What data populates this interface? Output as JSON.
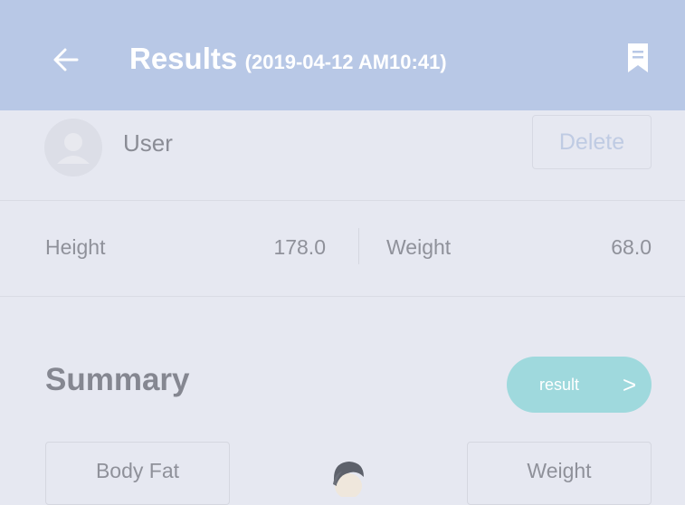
{
  "header": {
    "back_icon": "arrow-left-icon",
    "title": "Results",
    "timestamp": "(2019-04-12 AM10:41)",
    "bookmark_icon": "bookmark-icon",
    "background": "#b8c8e6"
  },
  "user": {
    "name": "User",
    "delete_label": "Delete"
  },
  "metrics": {
    "height_label": "Height",
    "height_value": "178.0",
    "weight_label": "Weight",
    "weight_value": "68.0"
  },
  "summary": {
    "title": "Summary",
    "result_label": "result",
    "result_chevron": ">",
    "accent": "#9fd9dd"
  },
  "tabs": {
    "body_fat": "Body Fat",
    "weight": "Weight"
  }
}
